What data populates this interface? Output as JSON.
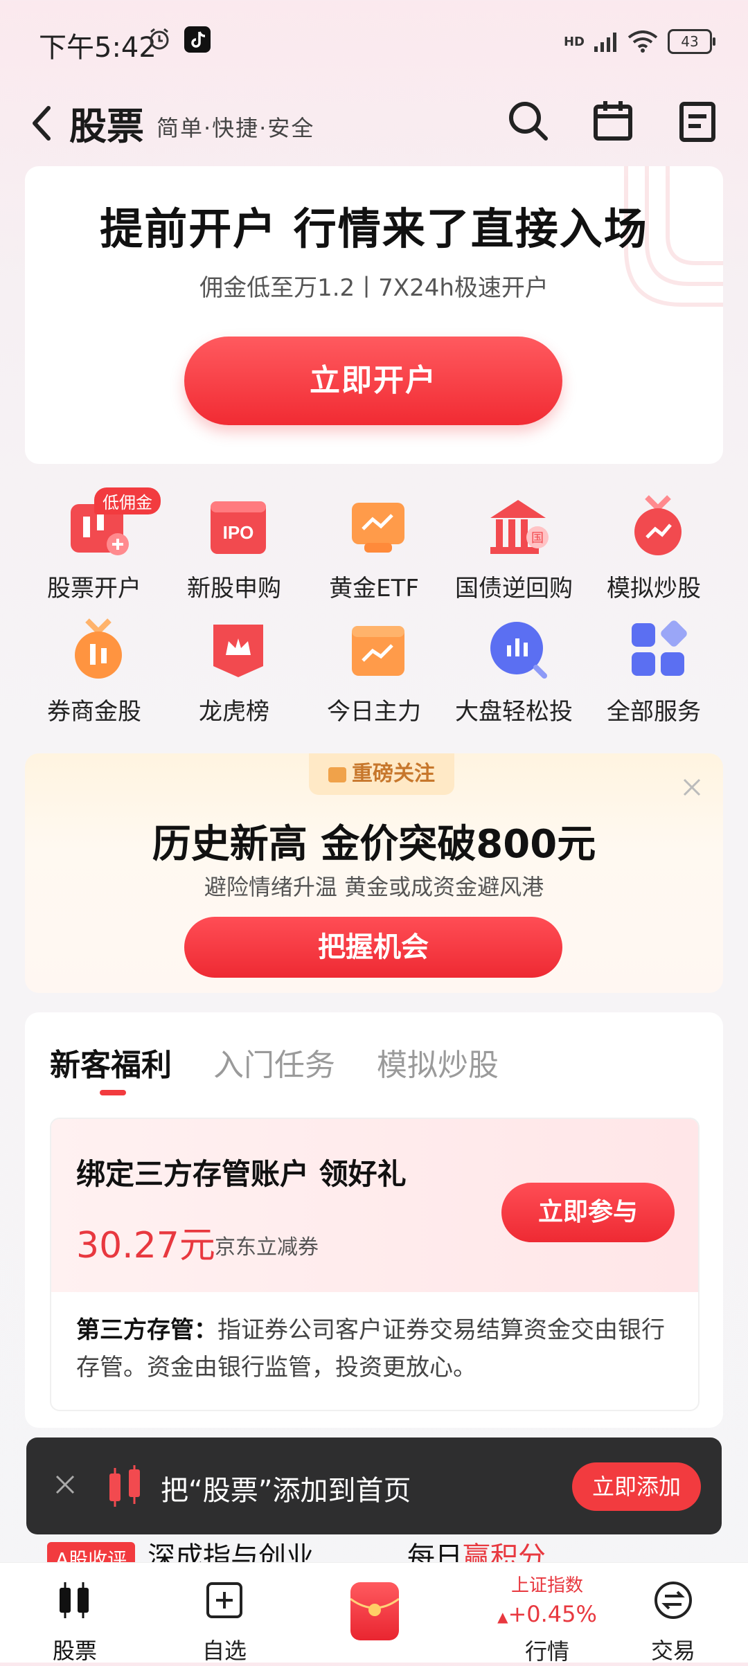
{
  "status": {
    "time": "下午5:42",
    "battery": "43",
    "network": "HD"
  },
  "header": {
    "title": "股票",
    "subtitle": "简单·快捷·安全"
  },
  "open_card": {
    "title": "提前开户 行情来了直接入场",
    "subtitle": "佣金低至万1.2丨7X24h极速开户",
    "button": "立即开户"
  },
  "services": [
    {
      "label": "股票开户",
      "badge": "低佣金",
      "icon": "stock-account-icon"
    },
    {
      "label": "新股申购",
      "icon": "ipo-icon"
    },
    {
      "label": "黄金ETF",
      "icon": "gold-etf-icon"
    },
    {
      "label": "国债逆回购",
      "icon": "treasury-repo-icon"
    },
    {
      "label": "模拟炒股",
      "icon": "simulated-trading-icon"
    },
    {
      "label": "券商金股",
      "icon": "broker-gold-stock-icon"
    },
    {
      "label": "龙虎榜",
      "icon": "dragon-tiger-list-icon"
    },
    {
      "label": "今日主力",
      "icon": "main-force-icon"
    },
    {
      "label": "大盘轻松投",
      "icon": "market-invest-icon"
    },
    {
      "label": "全部服务",
      "icon": "all-services-icon"
    }
  ],
  "promo": {
    "tag": "重磅关注",
    "title": "历史新高 金价突破800元",
    "subtitle": "避险情绪升温 黄金或成资金避风港",
    "button": "把握机会"
  },
  "tasks": {
    "tabs": [
      "新客福利",
      "入门任务",
      "模拟炒股"
    ],
    "offer_title": "绑定三方存管账户 领好礼",
    "amount": "30.27元",
    "amount_desc": "京东立减券",
    "button": "立即参与",
    "desc_label": "第三方存管：",
    "desc_text": "指证券公司客户证券交易结算资金交由银行存管。资金由银行监管，投资更放心。"
  },
  "peek": {
    "tag": "A股收评",
    "text1": "深成指与创业",
    "text2_a": "每日",
    "text2_b": "赢积分"
  },
  "toast": {
    "text": "把“股票”添加到首页",
    "button": "立即添加"
  },
  "nav": {
    "items": [
      "股票",
      "自选",
      "行情",
      "交易"
    ],
    "index_name": "上证指数",
    "index_value": "+0.45%"
  }
}
